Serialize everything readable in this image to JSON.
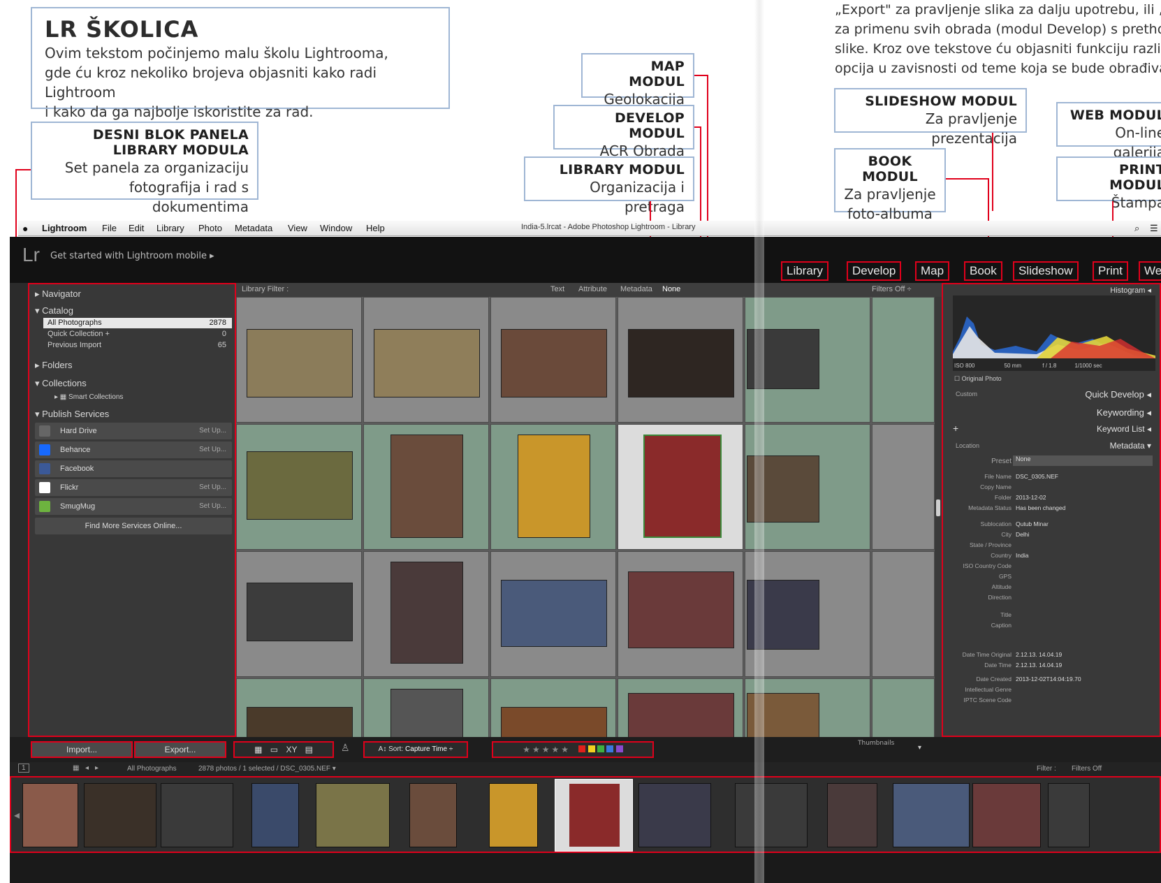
{
  "intro": {
    "title": "LR ŠKOLICA",
    "lines": [
      "Ovim tekstom počinjemo malu školu Lightrooma,",
      "gde ću kroz nekoliko brojeva objasniti kako radi Lightroom",
      "i kako da ga najbolje iskoristite za rad."
    ]
  },
  "right_text": [
    "„Export\" za pravljenje slika za dalju upotrebu, ili „Previ",
    "za primenu svih obrada (modul Develop) s prethod",
    "slike. Kroz ove tekstove ću objasniti funkciju različ",
    "opcija u zavisnosti od teme koja se bude obrađivala"
  ],
  "callouts": {
    "right_panel_block": {
      "title1": "DESNI BLOK PANELA",
      "title2": "LIBRARY MODULA",
      "desc1": "Set panela za organizaciju",
      "desc2": "fotografija i rad s dokumentima"
    },
    "map": {
      "title": "MAP MODUL",
      "desc": "Geolokacija"
    },
    "develop": {
      "title": "DEVELOP MODUL",
      "desc": "ACR Obrada"
    },
    "library": {
      "title": "LIBRARY MODUL",
      "desc": "Organizacija i pretraga"
    },
    "slideshow": {
      "title": "SLIDESHOW MODUL",
      "desc": "Za pravljenje prezentacija"
    },
    "book": {
      "title": "BOOK MODUL",
      "desc1": "Za pravljenje",
      "desc2": "foto-albuma"
    },
    "web": {
      "title": "WEB MODUL",
      "desc": "On-line galerija"
    },
    "print": {
      "title": "PRINT MODUL",
      "desc": "Štampa"
    }
  },
  "menubar": {
    "app": "Lightroom",
    "items": [
      "File",
      "Edit",
      "Library",
      "Photo",
      "Metadata",
      "View",
      "Window",
      "Help"
    ],
    "window_title": "India-5.lrcat - Adobe Photoshop Lightroom - Library"
  },
  "lr": {
    "logo": "Lr",
    "mobile": "Get started with Lightroom mobile  ▸",
    "modules": [
      "Library",
      "Develop",
      "Map",
      "Book",
      "Slideshow",
      "Print",
      "We"
    ],
    "left": {
      "navigator": "Navigator",
      "catalog": "Catalog",
      "catalog_items": [
        {
          "label": "All Photographs",
          "count": "2878"
        },
        {
          "label": "Quick Collection +",
          "count": "0"
        },
        {
          "label": "Previous Import",
          "count": "65"
        }
      ],
      "folders": "Folders",
      "collections": "Collections",
      "smart_collections": "Smart Collections",
      "publish": "Publish Services",
      "services": [
        {
          "label": "Hard Drive",
          "action": "Set Up...",
          "color": "#666666"
        },
        {
          "label": "Behance",
          "action": "Set Up...",
          "color": "#1769ff"
        },
        {
          "label": "Facebook",
          "action": "",
          "color": "#3b5998"
        },
        {
          "label": "Flickr",
          "action": "Set Up...",
          "color": "#ffffff"
        },
        {
          "label": "SmugMug",
          "action": "Set Up...",
          "color": "#6db33f"
        }
      ],
      "find_more": "Find More Services Online..."
    },
    "filter": {
      "label": "Library Filter :",
      "options": [
        "Text",
        "Attribute",
        "Metadata",
        "None"
      ],
      "filters_off": "Filters Off ÷"
    },
    "right": {
      "histogram": "Histogram ◂",
      "exif": [
        "ISO 800",
        "50 mm",
        "f / 1.8",
        "1/1000 sec"
      ],
      "original": "Original Photo",
      "custom": "Custom",
      "quick_develop": "Quick Develop ◂",
      "keywording": "Keywording ◂",
      "keyword_list": "Keyword List ◂",
      "location": "Location",
      "metadata": "Metadata ▾",
      "preset_key": "Preset",
      "preset_val": "None",
      "meta": [
        {
          "k": "File Name",
          "v": "DSC_0305.NEF"
        },
        {
          "k": "Copy Name",
          "v": ""
        },
        {
          "k": "Folder",
          "v": "2013-12-02"
        },
        {
          "k": "Metadata Status",
          "v": "Has been changed"
        },
        {
          "k": "Sublocation",
          "v": "Qutub Minar"
        },
        {
          "k": "City",
          "v": "Delhi"
        },
        {
          "k": "State / Province",
          "v": ""
        },
        {
          "k": "Country",
          "v": "India"
        },
        {
          "k": "ISO Country Code",
          "v": ""
        },
        {
          "k": "GPS",
          "v": ""
        },
        {
          "k": "Altitude",
          "v": ""
        },
        {
          "k": "Direction",
          "v": ""
        },
        {
          "k": "Title",
          "v": ""
        },
        {
          "k": "Caption",
          "v": ""
        },
        {
          "k": "Date Time Original",
          "v": "2.12.13. 14.04.19"
        },
        {
          "k": "Date Time",
          "v": "2.12.13. 14.04.19"
        },
        {
          "k": "Date Created",
          "v": "2013-12-02T14:04:19.70"
        },
        {
          "k": "Intellectual Genre",
          "v": ""
        },
        {
          "k": "IPTC Scene Code",
          "v": ""
        }
      ]
    },
    "toolbar": {
      "import": "Import...",
      "export": "Export...",
      "sort": "Sort:",
      "sort_value": "Capture Time ÷",
      "thumbnails": "Thumbnails"
    },
    "filmstrip": {
      "source": "All Photographs",
      "count": "2878 photos / 1 selected / DSC_0305.NEF ▾",
      "filter": "Filter :",
      "filters_off": "Filters Off"
    }
  },
  "colors": {
    "accent_red": "#e0001b",
    "callout_border": "#9fb6d4",
    "cell_green": "#7f9b89"
  }
}
